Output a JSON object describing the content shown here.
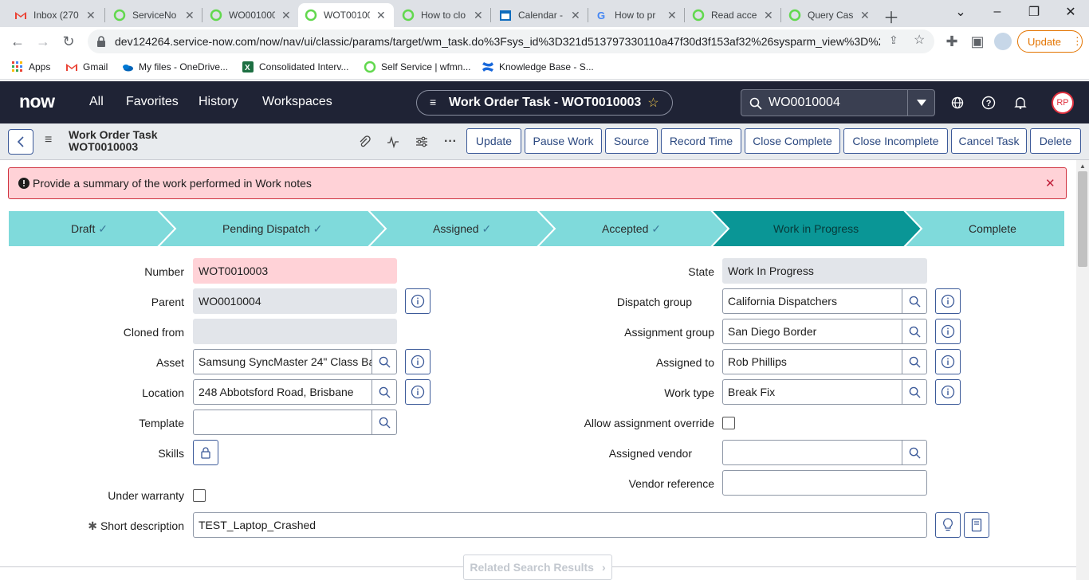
{
  "browser": {
    "tabs": [
      {
        "title": "Inbox (270",
        "icon": "gmail-icon",
        "active": false
      },
      {
        "title": "ServiceNo",
        "icon": "servicenow-icon",
        "active": false
      },
      {
        "title": "WO001000",
        "icon": "servicenow-icon",
        "active": false
      },
      {
        "title": "WOT00100",
        "icon": "servicenow-icon",
        "active": true
      },
      {
        "title": "How to clo",
        "icon": "servicenow-icon",
        "active": false
      },
      {
        "title": "Calendar -",
        "icon": "calendar-icon",
        "active": false
      },
      {
        "title": "How to pr",
        "icon": "google-icon",
        "active": false
      },
      {
        "title": "Read acce",
        "icon": "servicenow-icon",
        "active": false
      },
      {
        "title": "Query Cas",
        "icon": "servicenow-icon",
        "active": false
      }
    ],
    "url": "dev124264.service-now.com/now/nav/ui/classic/params/target/wm_task.do%3Fsys_id%3D321d513797330110a47f30d3f153af32%26sysparm_view%3D%2...",
    "update_label": "Update",
    "bookmarks": [
      {
        "label": "Apps",
        "icon": "apps-grid-icon"
      },
      {
        "label": "Gmail",
        "icon": "gmail-icon"
      },
      {
        "label": "My files - OneDrive...",
        "icon": "onedrive-icon"
      },
      {
        "label": "Consolidated Interv...",
        "icon": "excel-icon"
      },
      {
        "label": "Self Service | wfmn...",
        "icon": "servicenow-icon"
      },
      {
        "label": "Knowledge Base - S...",
        "icon": "confluence-icon"
      }
    ]
  },
  "header": {
    "logo": "now",
    "menus": [
      "All",
      "Favorites",
      "History",
      "Workspaces"
    ],
    "context_title": "Work Order Task - WOT0010003",
    "search_value": "WO0010004",
    "avatar_initials": "RP"
  },
  "form_header": {
    "title_line1": "Work Order Task",
    "title_line2": "WOT0010003",
    "actions": [
      "Update",
      "Pause Work",
      "Source",
      "Record Time",
      "Close Complete",
      "Close Incomplete",
      "Cancel Task",
      "Delete"
    ]
  },
  "alert": {
    "message": "Provide a summary of the work performed in Work notes"
  },
  "stages": [
    {
      "label": "Draft",
      "done": true
    },
    {
      "label": "Pending Dispatch",
      "done": true
    },
    {
      "label": "Assigned",
      "done": true
    },
    {
      "label": "Accepted",
      "done": true
    },
    {
      "label": "Work in Progress",
      "current": true
    },
    {
      "label": "Complete",
      "done": false
    }
  ],
  "form": {
    "left": {
      "number": {
        "label": "Number",
        "value": "WOT0010003"
      },
      "parent": {
        "label": "Parent",
        "value": "WO0010004"
      },
      "cloned_from": {
        "label": "Cloned from",
        "value": ""
      },
      "asset": {
        "label": "Asset",
        "value": "Samsung SyncMaster 24\" Class Ba"
      },
      "location": {
        "label": "Location",
        "value": "248 Abbotsford Road, Brisbane"
      },
      "template": {
        "label": "Template",
        "value": ""
      },
      "skills": {
        "label": "Skills"
      },
      "under_warranty": {
        "label": "Under warranty"
      }
    },
    "right": {
      "state": {
        "label": "State",
        "value": "Work In Progress"
      },
      "dispatch_group": {
        "label": "Dispatch group",
        "value": "California Dispatchers"
      },
      "assignment_group": {
        "label": "Assignment group",
        "value": "San Diego Border"
      },
      "assigned_to": {
        "label": "Assigned to",
        "value": "Rob Phillips"
      },
      "work_type": {
        "label": "Work type",
        "value": "Break Fix"
      },
      "allow_override": {
        "label": "Allow assignment override"
      },
      "assigned_vendor": {
        "label": "Assigned vendor",
        "value": ""
      },
      "vendor_reference": {
        "label": "Vendor reference",
        "value": ""
      }
    },
    "short_description": {
      "label": "Short description",
      "value": "TEST_Laptop_Crashed",
      "required_mark": "✱"
    },
    "related_search": "Related Search Results"
  },
  "colors": {
    "header_bg": "#1f2335",
    "stage_done": "#7fdadb",
    "stage_current": "#0a9696",
    "alert_bg": "#ffd2d7",
    "button_border": "#3c5a99"
  }
}
